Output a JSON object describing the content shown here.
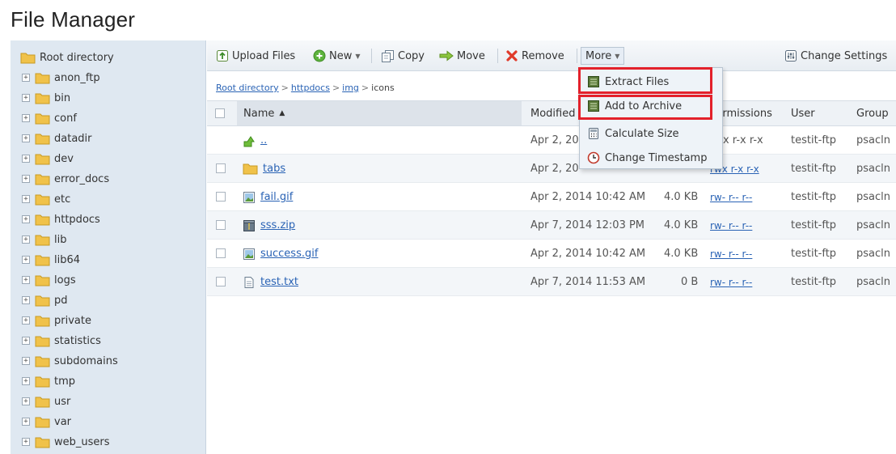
{
  "title": "File Manager",
  "sidebar": {
    "root": "Root directory",
    "items": [
      "anon_ftp",
      "bin",
      "conf",
      "datadir",
      "dev",
      "error_docs",
      "etc",
      "httpdocs",
      "lib",
      "lib64",
      "logs",
      "pd",
      "private",
      "statistics",
      "subdomains",
      "tmp",
      "usr",
      "var",
      "web_users"
    ]
  },
  "toolbar": {
    "upload": "Upload Files",
    "new": "New",
    "copy": "Copy",
    "move": "Move",
    "remove": "Remove",
    "more": "More",
    "change_settings": "Change Settings"
  },
  "breadcrumb": [
    "Root directory",
    "httpdocs",
    "img",
    "icons"
  ],
  "table": {
    "headers": {
      "name": "Name",
      "modified": "Modified",
      "permissions": "Permissions",
      "user": "User",
      "group": "Group"
    },
    "rows": [
      {
        "name": "..",
        "modified": "Apr 2, 20",
        "size": "",
        "permissions": "rwx r-x r-x",
        "user": "testit-ftp",
        "group": "psacln",
        "kind": "up"
      },
      {
        "name": "tabs",
        "modified": "Apr 2, 20",
        "size": "",
        "permissions": "rwx r-x r-x",
        "user": "testit-ftp",
        "group": "psacln",
        "kind": "folder"
      },
      {
        "name": "fail.gif",
        "modified": "Apr 2, 2014 10:42 AM",
        "size": "4.0 KB",
        "permissions": "rw- r-- r--",
        "user": "testit-ftp",
        "group": "psacln",
        "kind": "image"
      },
      {
        "name": "sss.zip",
        "modified": "Apr 7, 2014 12:03 PM",
        "size": "4.0 KB",
        "permissions": "rw- r-- r--",
        "user": "testit-ftp",
        "group": "psacln",
        "kind": "archive"
      },
      {
        "name": "success.gif",
        "modified": "Apr 2, 2014 10:42 AM",
        "size": "4.0 KB",
        "permissions": "rw- r-- r--",
        "user": "testit-ftp",
        "group": "psacln",
        "kind": "image"
      },
      {
        "name": "test.txt",
        "modified": "Apr 7, 2014 11:53 AM",
        "size": "0 B",
        "permissions": "rw- r-- r--",
        "user": "testit-ftp",
        "group": "psacln",
        "kind": "text"
      }
    ]
  },
  "more_menu": {
    "items": [
      "Extract Files",
      "Add to Archive",
      "Calculate Size",
      "Change Timestamp"
    ]
  },
  "colors": {
    "highlight": "#e3212b",
    "link": "#2a63b5",
    "sidebar_bg": "#dfe8f1"
  }
}
